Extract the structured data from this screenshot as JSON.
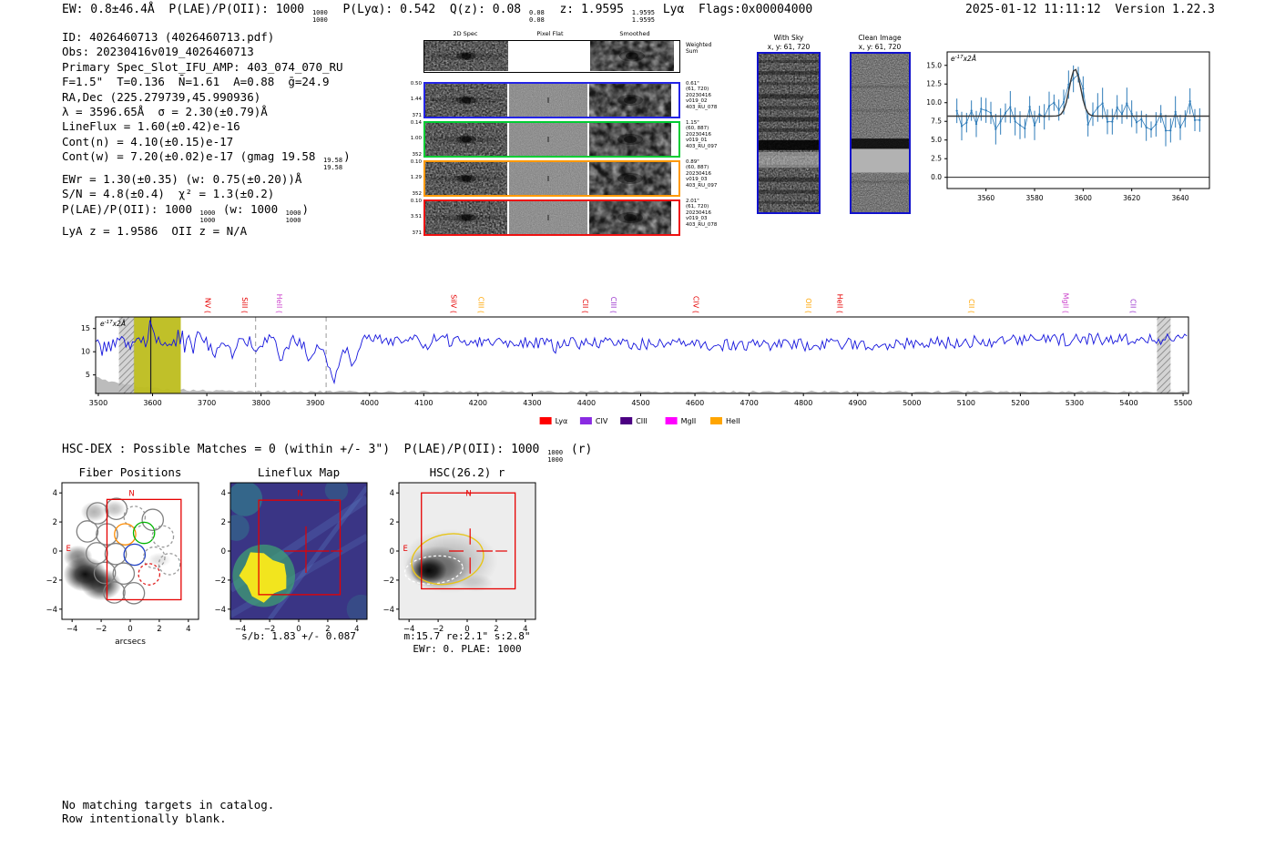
{
  "header": {
    "left_segments": [
      {
        "t": "EW: 0.8±46.4Å  P(LAE)/P(OII): 1000 "
      },
      {
        "frac": [
          "1000",
          "1000"
        ]
      },
      {
        "t": "  P(Lyα): 0.542  Q(z): 0.08 "
      },
      {
        "frac": [
          "0.08",
          "0.08"
        ]
      },
      {
        "t": "  z: 1.9595 "
      },
      {
        "frac": [
          "1.9595",
          "1.9595"
        ]
      },
      {
        "t": " Lyα  Flags:0x00004000"
      }
    ],
    "datetime": "2025-01-12 11:11:12",
    "version": "Version 1.22.3"
  },
  "info_block": {
    "lines": [
      [
        {
          "t": "ID: 4026460713 (4026460713.pdf)"
        }
      ],
      [
        {
          "t": "Obs: 20230416v019_4026460713"
        }
      ],
      [
        {
          "t": "Primary Spec_Slot_IFU_AMP: 403_074_070_RU"
        }
      ],
      [
        {
          "t": "F=1.5\"  T=0.136  N̄=1.61  A=0.88  ḡ=24.9"
        }
      ],
      [
        {
          "t": "RA,Dec (225.279739,45.990936)"
        }
      ],
      [
        {
          "t": "λ = 3596.65Å  σ = 2.30(±0.79)Å"
        }
      ],
      [
        {
          "t": "LineFlux = 1.60(±0.42)e-16"
        }
      ],
      [
        {
          "t": "Cont(n) = 4.10(±0.15)e-17"
        }
      ],
      [
        {
          "t": "Cont(w) = 7.20(±0.02)e-17 (gmag 19.58 "
        },
        {
          "frac": [
            "19.58",
            "19.58"
          ]
        },
        {
          "t": ")"
        }
      ],
      [
        {
          "t": "EWr = 1.30(±0.35) (w: 0.75(±0.20))Å"
        }
      ],
      [
        {
          "t": "S/N = 4.8(±0.4)  χ² = 1.3(±0.2)"
        }
      ],
      [
        {
          "t": "P(LAE)/P(OII): 1000 "
        },
        {
          "frac": [
            "1000",
            "1000"
          ]
        },
        {
          "t": " (w: 1000 "
        },
        {
          "frac": [
            "1000",
            "1000"
          ]
        },
        {
          "t": ")"
        }
      ],
      [
        {
          "t": "LyA z = 1.9586  OII z = N/A"
        }
      ]
    ]
  },
  "cutouts": {
    "columns": [
      "2D Spec",
      "Pixel Flat",
      "Smoothed"
    ],
    "weighted_label": [
      "Weighted",
      "Sum"
    ],
    "rows": [
      {
        "left": [
          "0.50",
          "1.44",
          "371"
        ],
        "border": "#2424e6",
        "right": [
          "0.61\"",
          "(61, 720)",
          "20230416",
          "v019_02",
          "403_RU_078"
        ]
      },
      {
        "left": [
          "0.14",
          "1.00",
          "352"
        ],
        "border": "#00cc33",
        "right": [
          "1.15\"",
          "(60, 887)",
          "20230416",
          "v019_01",
          "403_RU_097"
        ]
      },
      {
        "left": [
          "0.10",
          "1.29",
          "352"
        ],
        "border": "#ff9900",
        "right": [
          "0.89\"",
          "(60, 887)",
          "20230416",
          "v019_03",
          "403_RU_097"
        ]
      },
      {
        "left": [
          "0.10",
          "3.51",
          "371"
        ],
        "border": "#ee1111",
        "right": [
          "2.01\"",
          "(61, 720)",
          "20230416",
          "v019_03",
          "403_RU_078"
        ]
      }
    ]
  },
  "postage": {
    "with_sky": {
      "title": "With Sky",
      "subtitle": "x, y: 61, 720"
    },
    "clean": {
      "title": "Clean Image",
      "subtitle": "x, y: 61, 720"
    }
  },
  "hsc": {
    "segments": [
      {
        "t": "HSC-DEX : Possible Matches = 0 (within +/- 3\")  P(LAE)/P(OII): 1000 "
      },
      {
        "frac": [
          "1000",
          "1000"
        ]
      },
      {
        "t": " (r)"
      }
    ]
  },
  "notes": [
    "No matching targets in catalog.",
    "Row intentionally blank."
  ],
  "chart_data": [
    {
      "id": "zoom_spectrum",
      "type": "line_errorbar",
      "annotation": {
        "prefix": "e",
        "exp": "-17",
        "suffix": "x2Å"
      },
      "xlim": [
        3544,
        3652
      ],
      "ylim": [
        -1.5,
        16.8
      ],
      "xticks": [
        3560,
        3580,
        3600,
        3620,
        3640
      ],
      "yticks": [
        0,
        2.5,
        5,
        7.5,
        10,
        12.5,
        15
      ],
      "continuum": 8.2,
      "gaussian_fit": {
        "x": 3596.65,
        "sigma": 2.3,
        "amplitude": 6.3
      },
      "data_color": "#2e7bb8",
      "fit_color": "#3a3a3a"
    },
    {
      "id": "full_spectrum",
      "type": "line",
      "annotation": {
        "prefix": "e",
        "exp": "-17",
        "suffix": "x2Å"
      },
      "xlim": [
        3495,
        5510
      ],
      "ylim": [
        1,
        17.5
      ],
      "xticks": [
        3500,
        3600,
        3700,
        3800,
        3900,
        4000,
        4100,
        4200,
        4300,
        4400,
        4500,
        4600,
        4700,
        4800,
        4900,
        5000,
        5100,
        5200,
        5300,
        5400,
        5500
      ],
      "yticks": [
        5,
        10,
        15
      ],
      "baseline": 11.8,
      "emission": {
        "x": 3596.65,
        "amplitude": 3.6,
        "sigma": 4
      },
      "absorption_dips": [
        {
          "x": 3712,
          "a": 2.5,
          "s": 8
        },
        {
          "x": 3748,
          "a": 3,
          "s": 6
        },
        {
          "x": 3792,
          "a": 3,
          "s": 7
        },
        {
          "x": 3838,
          "a": 4,
          "s": 8
        },
        {
          "x": 3892,
          "a": 5,
          "s": 9
        },
        {
          "x": 3934,
          "a": 8.5,
          "s": 10
        },
        {
          "x": 3968,
          "a": 5,
          "s": 7
        },
        {
          "x": 4102,
          "a": 2,
          "s": 6
        },
        {
          "x": 4341,
          "a": 1.5,
          "s": 5
        }
      ],
      "yellow_band": [
        3565,
        3652
      ],
      "hatch_bands": [
        [
          3538,
          3566
        ],
        [
          5452,
          5477
        ]
      ],
      "dashed_lines": [
        3790,
        3920
      ],
      "detection_line": 3596.65,
      "line_color": "#1515dd",
      "error_color": "#b5b5b5",
      "line_labels": [
        {
          "text": "NV",
          "x": 3692,
          "color": "#e60000"
        },
        {
          "text": "SiII",
          "x": 3760,
          "color": "#e60000"
        },
        {
          "text": "HeII",
          "x": 3824,
          "color": "#cc44cc"
        },
        {
          "text": "SiIV",
          "x": 4146,
          "color": "#e60000"
        },
        {
          "text": "CIII",
          "x": 4196,
          "color": "#ffa500"
        },
        {
          "text": "CII",
          "x": 4388,
          "color": "#e60000"
        },
        {
          "text": "CIII",
          "x": 4440,
          "color": "#9933cc"
        },
        {
          "text": "CIV",
          "x": 4592,
          "color": "#e60000"
        },
        {
          "text": "OII",
          "x": 4800,
          "color": "#ffa500"
        },
        {
          "text": "HeII",
          "x": 4858,
          "color": "#e60000"
        },
        {
          "text": "CII",
          "x": 5100,
          "color": "#ffa500"
        },
        {
          "text": "MgII",
          "x": 5274,
          "color": "#cc44cc"
        },
        {
          "text": "CII",
          "x": 5398,
          "color": "#9933cc"
        }
      ],
      "legend": [
        {
          "label": "Lyα",
          "color": "#ff0000"
        },
        {
          "label": "CIV",
          "color": "#8a2be2"
        },
        {
          "label": "CIII",
          "color": "#4b0082"
        },
        {
          "label": "MgII",
          "color": "#ff00ff"
        },
        {
          "label": "HeII",
          "color": "#ffa500"
        }
      ]
    },
    {
      "id": "fiber_positions",
      "type": "scatter",
      "title": "Fiber Positions",
      "xlabel": "arcsecs",
      "xlim": [
        -4.7,
        4.7
      ],
      "ylim": [
        -4.7,
        4.7
      ],
      "ticks": [
        -4,
        -2,
        0,
        2,
        4
      ],
      "compass": {
        "north": "N",
        "east": "E"
      },
      "selection_rect": [
        -1.6,
        -3.35,
        5.1,
        6.9
      ],
      "fiber_radius": 0.73,
      "fibers": [
        {
          "x": -2.25,
          "y": 2.6,
          "color": "#808080",
          "dashed": false
        },
        {
          "x": -0.95,
          "y": 2.9,
          "color": "#808080",
          "dashed": false
        },
        {
          "x": 0.3,
          "y": 2.35,
          "color": "#9a9a9a",
          "dashed": true
        },
        {
          "x": 1.55,
          "y": 2.15,
          "color": "#808080",
          "dashed": false
        },
        {
          "x": -2.95,
          "y": 1.35,
          "color": "#808080",
          "dashed": false
        },
        {
          "x": -1.6,
          "y": 1.15,
          "color": "#808080",
          "dashed": false
        },
        {
          "x": -0.35,
          "y": 1.15,
          "color": "#ff8c00",
          "dashed": false
        },
        {
          "x": 0.95,
          "y": 1.25,
          "color": "#00b400",
          "dashed": false
        },
        {
          "x": 2.25,
          "y": 1.0,
          "color": "#9a9a9a",
          "dashed": true
        },
        {
          "x": -2.3,
          "y": -0.15,
          "color": "#808080",
          "dashed": false
        },
        {
          "x": -1.0,
          "y": -0.2,
          "color": "#808080",
          "dashed": false
        },
        {
          "x": 0.3,
          "y": -0.25,
          "color": "#1f3fc4",
          "dashed": false
        },
        {
          "x": 1.65,
          "y": -0.45,
          "color": "#9a9a9a",
          "dashed": true
        },
        {
          "x": 2.7,
          "y": -0.9,
          "color": "#9a9a9a",
          "dashed": true
        },
        {
          "x": -1.75,
          "y": -1.5,
          "color": "#808080",
          "dashed": false
        },
        {
          "x": -0.45,
          "y": -1.55,
          "color": "#808080",
          "dashed": false
        },
        {
          "x": 1.3,
          "y": -1.6,
          "color": "#e02020",
          "dashed": true
        },
        {
          "x": -1.1,
          "y": -2.85,
          "color": "#808080",
          "dashed": false
        },
        {
          "x": 0.25,
          "y": -2.9,
          "color": "#808080",
          "dashed": false
        }
      ]
    },
    {
      "id": "lineflux_map",
      "type": "heatmap",
      "title": "Lineflux Map",
      "caption": "s/b: 1.83 +/- 0.087",
      "xlim": [
        -4.7,
        4.7
      ],
      "ylim": [
        -4.7,
        4.7
      ],
      "ticks": [
        -4,
        -2,
        0,
        2,
        4
      ],
      "compass": {
        "north": "N"
      },
      "selection_rect": [
        -2.75,
        -3.0,
        5.6,
        6.5
      ],
      "crosshair": {
        "x": 0.5,
        "y": 0.0
      },
      "bright_blob": {
        "x": -2.4,
        "y": -1.7,
        "r": 1.55
      },
      "background_color": "#3a3585",
      "blob_color": "#f2e51e"
    },
    {
      "id": "hsc_r",
      "type": "image",
      "title": "HSC(26.2) r",
      "captions": [
        "m:15.7 re:2.1\" s:2.8\"",
        "EWr: 0. PLAE: 1000"
      ],
      "xlim": [
        -4.7,
        4.7
      ],
      "ylim": [
        -4.7,
        4.7
      ],
      "ticks": [
        -4,
        -2,
        0,
        2,
        4
      ],
      "compass": {
        "north": "N",
        "east": "E"
      },
      "selection_rect": [
        -3.15,
        -2.6,
        6.45,
        6.6
      ],
      "crosshair": {
        "x": 0.2,
        "y": 0.0
      },
      "aperture_ellipse": {
        "x": -1.35,
        "y": -0.55,
        "rx": 2.5,
        "ry": 1.7,
        "angle": -12,
        "color": "#e7c51a"
      },
      "petrosian_ellipse": {
        "x": -2.3,
        "y": -1.3,
        "rx": 2.0,
        "ry": 0.95,
        "angle": -6,
        "color": "#ffffff"
      }
    }
  ]
}
